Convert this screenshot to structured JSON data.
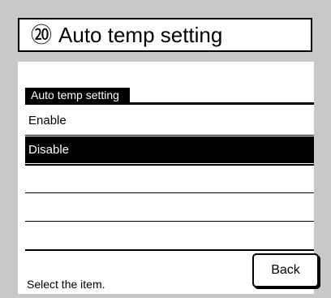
{
  "header": {
    "number": "⑳",
    "title": "Auto temp setting"
  },
  "section": {
    "label": "Auto temp setting"
  },
  "options": [
    {
      "label": "Enable",
      "selected": false
    },
    {
      "label": "Disable",
      "selected": true
    }
  ],
  "status": {
    "text": "Select the item."
  },
  "buttons": {
    "back": "Back"
  }
}
